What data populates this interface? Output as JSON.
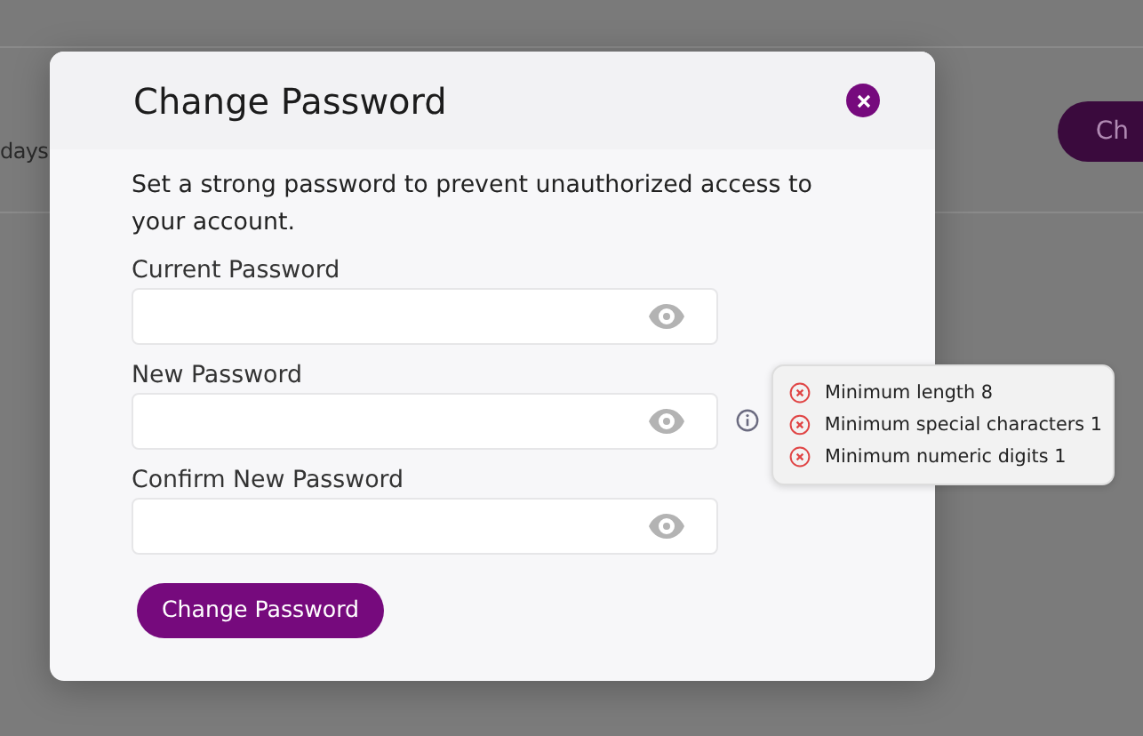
{
  "background": {
    "text": "days",
    "button": "Ch"
  },
  "dialog": {
    "title": "Change Password",
    "description": "Set a strong password to prevent unauthorized access to your account.",
    "fields": [
      {
        "label": "Current Password",
        "hint": false
      },
      {
        "label": "New Password",
        "hint": true
      },
      {
        "label": "Confirm New Password",
        "hint": false
      }
    ],
    "rules": [
      {
        "text": "Minimum length 8",
        "met": false
      },
      {
        "text": "Minimum special characters 1",
        "met": false
      },
      {
        "text": "Minimum numeric digits 1",
        "met": false
      }
    ],
    "submit": "Change Password"
  }
}
